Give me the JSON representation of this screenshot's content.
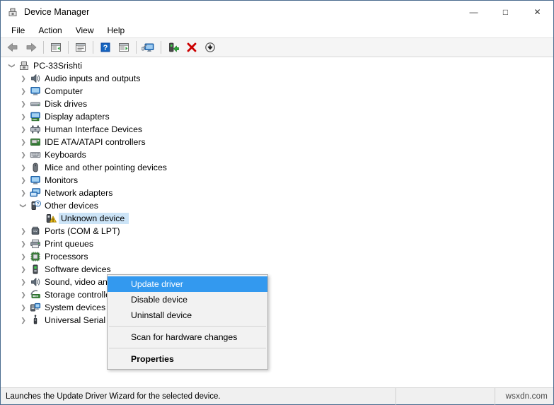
{
  "window": {
    "title": "Device Manager",
    "icon": "device-manager-icon",
    "caption_buttons": [
      {
        "name": "minimize-button",
        "glyph": "—"
      },
      {
        "name": "maximize-button",
        "glyph": "□"
      },
      {
        "name": "close-button",
        "glyph": "✕"
      }
    ]
  },
  "menubar": {
    "items": [
      {
        "label": "File"
      },
      {
        "label": "Action"
      },
      {
        "label": "View"
      },
      {
        "label": "Help"
      }
    ]
  },
  "toolbar": {
    "buttons": [
      {
        "name": "back-button",
        "icon": "back-arrow-icon"
      },
      {
        "name": "forward-button",
        "icon": "forward-arrow-icon"
      },
      {
        "name": "separator-1",
        "icon": "separator"
      },
      {
        "name": "up-one-level-button",
        "icon": "window-list-icon"
      },
      {
        "name": "separator-2",
        "icon": "separator"
      },
      {
        "name": "properties-button",
        "icon": "properties-window-icon"
      },
      {
        "name": "separator-3",
        "icon": "separator"
      },
      {
        "name": "help-button",
        "icon": "help-question-icon"
      },
      {
        "name": "show-hidden-devices-button",
        "icon": "window-play-icon"
      },
      {
        "name": "separator-4",
        "icon": "separator"
      },
      {
        "name": "scan-for-hardware-changes-button",
        "icon": "monitor-scan-icon"
      },
      {
        "name": "separator-5",
        "icon": "separator"
      },
      {
        "name": "update-driver-button",
        "icon": "update-driver-icon"
      },
      {
        "name": "uninstall-device-button",
        "icon": "red-x-icon"
      },
      {
        "name": "disable-device-button",
        "icon": "down-arrow-circle-icon"
      }
    ]
  },
  "tree": {
    "root": {
      "label": "PC-33Srishti",
      "icon": "computer-root-icon",
      "expanded": true
    },
    "nodes": [
      {
        "label": "Audio inputs and outputs",
        "icon": "speaker-icon",
        "expandable": true,
        "selected": false
      },
      {
        "label": "Computer",
        "icon": "monitor-icon",
        "expandable": true,
        "selected": false
      },
      {
        "label": "Disk drives",
        "icon": "disk-drive-icon",
        "expandable": true,
        "selected": false
      },
      {
        "label": "Display adapters",
        "icon": "display-adapter-icon",
        "expandable": true,
        "selected": false
      },
      {
        "label": "Human Interface Devices",
        "icon": "hid-icon",
        "expandable": true,
        "selected": false
      },
      {
        "label": "IDE ATA/ATAPI controllers",
        "icon": "ide-controller-icon",
        "expandable": true,
        "selected": false
      },
      {
        "label": "Keyboards",
        "icon": "keyboard-icon",
        "expandable": true,
        "selected": false
      },
      {
        "label": "Mice and other pointing devices",
        "icon": "mouse-icon",
        "expandable": true,
        "selected": false
      },
      {
        "label": "Monitors",
        "icon": "monitor-icon",
        "expandable": true,
        "selected": false
      },
      {
        "label": "Network adapters",
        "icon": "network-adapter-icon",
        "expandable": true,
        "selected": false
      },
      {
        "label": "Other devices",
        "icon": "other-device-question-icon",
        "expandable": true,
        "expanded": true,
        "selected": false
      },
      {
        "label": "Unknown device",
        "icon": "unknown-device-warning-icon",
        "expandable": false,
        "child": true,
        "selected": true
      },
      {
        "label": "Ports (COM & LPT)",
        "icon": "port-icon",
        "expandable": true,
        "selected": false
      },
      {
        "label": "Print queues",
        "icon": "printer-icon",
        "expandable": true,
        "selected": false
      },
      {
        "label": "Processors",
        "icon": "processor-icon",
        "expandable": true,
        "selected": false
      },
      {
        "label": "Software devices",
        "icon": "software-device-icon",
        "expandable": true,
        "selected": false
      },
      {
        "label": "Sound, video and game controllers",
        "icon": "speaker-icon",
        "expandable": true,
        "selected": false
      },
      {
        "label": "Storage controllers",
        "icon": "storage-controller-icon",
        "expandable": true,
        "selected": false
      },
      {
        "label": "System devices",
        "icon": "system-device-icon",
        "expandable": true,
        "selected": false
      },
      {
        "label": "Universal Serial Bus controllers",
        "icon": "usb-icon",
        "expandable": true,
        "selected": false
      }
    ]
  },
  "context_menu": {
    "items": [
      {
        "label": "Update driver",
        "highlight": true,
        "bold": false
      },
      {
        "label": "Disable device",
        "highlight": false,
        "bold": false
      },
      {
        "label": "Uninstall device",
        "highlight": false,
        "bold": false
      },
      {
        "separator": true
      },
      {
        "label": "Scan for hardware changes",
        "highlight": false,
        "bold": false
      },
      {
        "separator": true
      },
      {
        "label": "Properties",
        "highlight": false,
        "bold": true
      }
    ]
  },
  "statusbar": {
    "message": "Launches the Update Driver Wizard for the selected device.",
    "middle": "",
    "watermark": "wsxdn.com"
  },
  "colors": {
    "selection_blue": "#cce4f7",
    "menu_highlight": "#3399ef",
    "window_border": "#4a6c8f",
    "toolbar_bg": "#f5f5f5",
    "statusbar_bg": "#f0f0f0",
    "warning_yellow": "#f5c518",
    "error_red": "#cc0000"
  }
}
